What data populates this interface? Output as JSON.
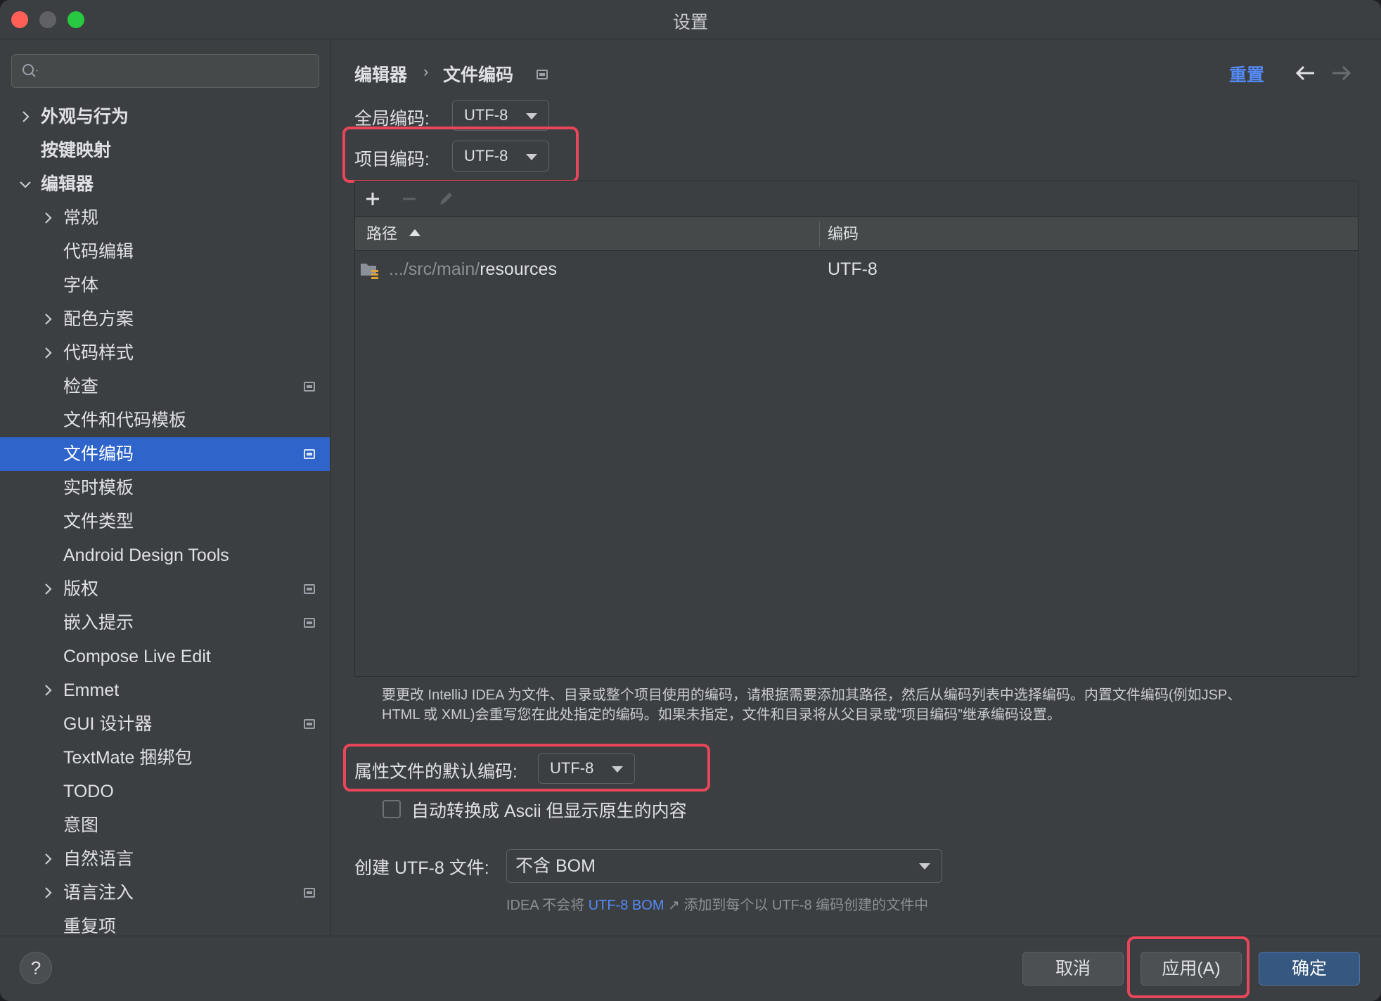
{
  "window": {
    "title": "设置"
  },
  "sidebar": {
    "search_placeholder": "",
    "items": [
      {
        "label": "外观与行为",
        "level": 0,
        "chevron": "right",
        "bold": true,
        "icon": false,
        "selected": false
      },
      {
        "label": "按键映射",
        "level": 0,
        "chevron": "none",
        "bold": true,
        "icon": false,
        "selected": false
      },
      {
        "label": "编辑器",
        "level": 0,
        "chevron": "down",
        "bold": true,
        "icon": false,
        "selected": false
      },
      {
        "label": "常规",
        "level": 1,
        "chevron": "right",
        "bold": false,
        "icon": false,
        "selected": false
      },
      {
        "label": "代码编辑",
        "level": 1,
        "chevron": "none",
        "bold": false,
        "icon": false,
        "selected": false
      },
      {
        "label": "字体",
        "level": 1,
        "chevron": "none",
        "bold": false,
        "icon": false,
        "selected": false
      },
      {
        "label": "配色方案",
        "level": 1,
        "chevron": "right",
        "bold": false,
        "icon": false,
        "selected": false
      },
      {
        "label": "代码样式",
        "level": 1,
        "chevron": "right",
        "bold": false,
        "icon": false,
        "selected": false
      },
      {
        "label": "检查",
        "level": 1,
        "chevron": "none",
        "bold": false,
        "icon": true,
        "selected": false
      },
      {
        "label": "文件和代码模板",
        "level": 1,
        "chevron": "none",
        "bold": false,
        "icon": false,
        "selected": false
      },
      {
        "label": "文件编码",
        "level": 1,
        "chevron": "none",
        "bold": false,
        "icon": true,
        "selected": true
      },
      {
        "label": "实时模板",
        "level": 1,
        "chevron": "none",
        "bold": false,
        "icon": false,
        "selected": false
      },
      {
        "label": "文件类型",
        "level": 1,
        "chevron": "none",
        "bold": false,
        "icon": false,
        "selected": false
      },
      {
        "label": "Android Design Tools",
        "level": 1,
        "chevron": "none",
        "bold": false,
        "icon": false,
        "selected": false
      },
      {
        "label": "版权",
        "level": 1,
        "chevron": "right",
        "bold": false,
        "icon": true,
        "selected": false
      },
      {
        "label": "嵌入提示",
        "level": 1,
        "chevron": "none",
        "bold": false,
        "icon": true,
        "selected": false
      },
      {
        "label": "Compose Live Edit",
        "level": 1,
        "chevron": "none",
        "bold": false,
        "icon": false,
        "selected": false
      },
      {
        "label": "Emmet",
        "level": 1,
        "chevron": "right",
        "bold": false,
        "icon": false,
        "selected": false
      },
      {
        "label": "GUI 设计器",
        "level": 1,
        "chevron": "none",
        "bold": false,
        "icon": true,
        "selected": false
      },
      {
        "label": "TextMate 捆绑包",
        "level": 1,
        "chevron": "none",
        "bold": false,
        "icon": false,
        "selected": false
      },
      {
        "label": "TODO",
        "level": 1,
        "chevron": "none",
        "bold": false,
        "icon": false,
        "selected": false
      },
      {
        "label": "意图",
        "level": 1,
        "chevron": "none",
        "bold": false,
        "icon": false,
        "selected": false
      },
      {
        "label": "自然语言",
        "level": 1,
        "chevron": "right",
        "bold": false,
        "icon": false,
        "selected": false
      },
      {
        "label": "语言注入",
        "level": 1,
        "chevron": "right",
        "bold": false,
        "icon": true,
        "selected": false
      },
      {
        "label": "重复项",
        "level": 1,
        "chevron": "none",
        "bold": false,
        "icon": false,
        "selected": false
      }
    ]
  },
  "header": {
    "breadcrumb_parent": "编辑器",
    "breadcrumb_sep": "›",
    "breadcrumb_current": "文件编码",
    "reset_label": "重置"
  },
  "global_encoding": {
    "label": "全局编码:",
    "value": "UTF-8"
  },
  "project_encoding": {
    "label": "项目编码:",
    "value": "UTF-8"
  },
  "table": {
    "columns": [
      "路径",
      "编码"
    ],
    "rows": [
      {
        "path_prefix": ".../src/main/",
        "path_name": "resources",
        "encoding": "UTF-8"
      }
    ]
  },
  "hint": {
    "line1": "要更改 IntelliJ IDEA 为文件、目录或整个项目使用的编码，请根据需要添加其路径，然后从编码列表中选择编码。内置文件编码(例如JSP、",
    "line2": "HTML 或 XML)会重写您在此处指定的编码。如果未指定，文件和目录将从父目录或“项目编码”继承编码设置。"
  },
  "properties_encoding": {
    "label": "属性文件的默认编码:",
    "value": "UTF-8"
  },
  "ascii_checkbox": {
    "label": "自动转换成 Ascii 但显示原生的内容",
    "checked": false
  },
  "create_utf8": {
    "label": "创建 UTF-8 文件:",
    "value": "不含 BOM"
  },
  "bom_note": {
    "prefix": "IDEA 不会将",
    "link": "UTF-8 BOM",
    "arrow": "↗",
    "suffix": "添加到每个以 UTF-8 编码创建的文件中"
  },
  "footer": {
    "help": "?",
    "cancel": "取消",
    "apply": "应用(A)",
    "ok": "确定"
  },
  "colors": {
    "selection": "#2f65ca",
    "link": "#548af7",
    "highlight": "#e8475a",
    "primary_button": "#365880"
  }
}
